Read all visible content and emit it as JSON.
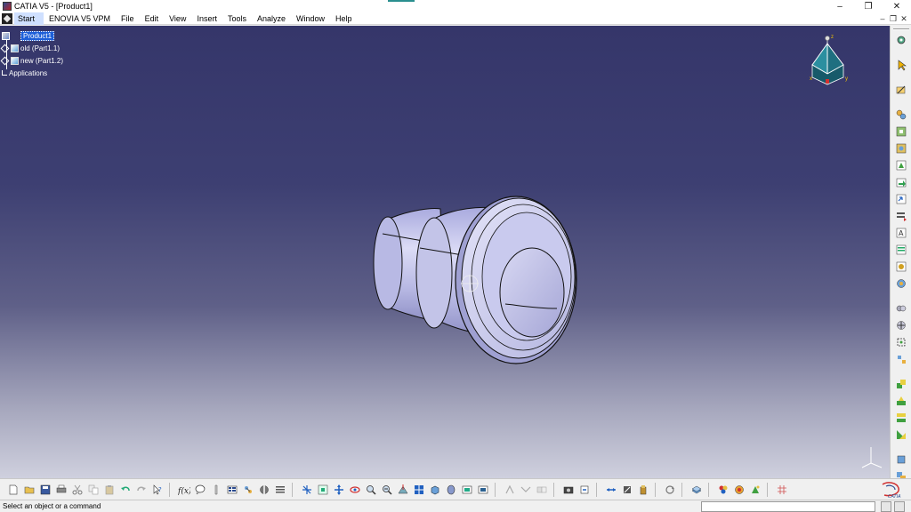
{
  "window": {
    "title": "CATIA V5 - [Product1]",
    "controls": [
      "–",
      "❐",
      "✕"
    ]
  },
  "menubar": {
    "items": [
      {
        "label": "Start",
        "active": true
      },
      {
        "label": "ENOVIA V5 VPM"
      },
      {
        "label": "File"
      },
      {
        "label": "Edit"
      },
      {
        "label": "View"
      },
      {
        "label": "Insert"
      },
      {
        "label": "Tools"
      },
      {
        "label": "Analyze"
      },
      {
        "label": "Window"
      },
      {
        "label": "Help"
      }
    ],
    "mdi_controls": [
      "–",
      "❐",
      "✕"
    ]
  },
  "spec_tree": {
    "root": "Product1",
    "children": [
      "old (Part1.1)",
      "new (Part1.2)"
    ],
    "applications": "Applications"
  },
  "compass": {
    "x_label": "x",
    "y_label": "y",
    "z_label": "z"
  },
  "statusbar": {
    "message": "Select an object or a command",
    "input_value": ""
  },
  "colors": {
    "viewport_top": "#35366a",
    "viewport_bottom": "#cfd0de",
    "part_body": "#cfd0f0",
    "tree_selection": "#1e5fd8"
  },
  "right_toolbar_icons": [
    "compass-icon",
    "select-arrow-icon",
    "sketch-icon",
    "assembly-icon",
    "new-component-icon",
    "new-product-icon",
    "new-part-icon",
    "existing-component-icon",
    "replace-component-icon",
    "graph-tree-icon",
    "generate-numbering-icon",
    "bill-of-material-icon",
    "fix-component-icon",
    "reorder-icon",
    "multi-instantiation-icon",
    "move-icon",
    "snap-icon",
    "explode-icon",
    "constraint-coincidence-icon",
    "constraint-contact-icon",
    "constraint-offset-icon",
    "constraint-angle-icon",
    "fix-icon",
    "fix-together-icon",
    "quick-constraint-icon",
    "update-icon"
  ],
  "bottom_toolbar_groups": [
    [
      "new-icon",
      "open-icon",
      "save-icon",
      "print-icon",
      "cut-icon",
      "copy-icon",
      "paste-icon",
      "undo-icon",
      "redo-icon",
      "whats-this-icon"
    ],
    [
      "formula-icon",
      "knowledge-icon",
      "measure-icon",
      "catalog-icon",
      "design-table-icon",
      "view-mode-icon",
      "macros-icon"
    ],
    [
      "fly-mode-icon",
      "fit-all-icon",
      "pan-icon",
      "rotate-icon",
      "zoom-in-icon",
      "zoom-out-icon",
      "normal-view-icon",
      "multi-view-icon",
      "iso-view-icon",
      "shading-icon",
      "hide-show-icon",
      "swap-visible-icon"
    ],
    [
      "clash-icon",
      "sectioning-icon",
      "distance-icon"
    ],
    [
      "camera-icon",
      "publish-icon"
    ],
    [
      "measure-between-icon",
      "measure-item-icon",
      "measure-inertia-icon"
    ],
    [
      "refresh-icon"
    ],
    [
      "layer-icon"
    ],
    [
      "apply-material-icon",
      "render-icon",
      "scenes-icon"
    ],
    [
      "grid-icon"
    ]
  ]
}
